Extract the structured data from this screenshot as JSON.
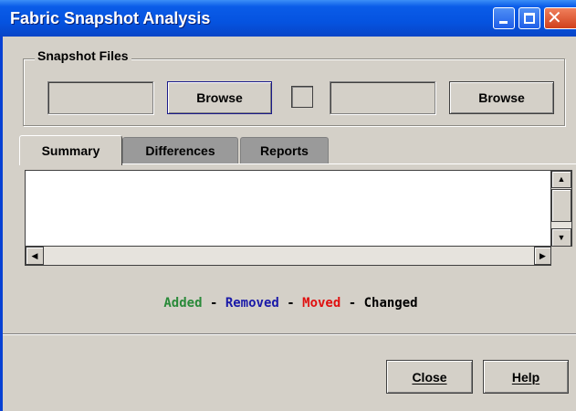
{
  "window": {
    "title": "Fabric Snapshot Analysis"
  },
  "snapshot_files": {
    "legend": "Snapshot Files",
    "left_file_value": "",
    "left_browse_label": "Browse",
    "right_file_value": "",
    "right_browse_label": "Browse"
  },
  "tabs": [
    {
      "label": "Summary",
      "active": true
    },
    {
      "label": "Differences",
      "active": false
    },
    {
      "label": "Reports",
      "active": false
    }
  ],
  "summary_text": "",
  "legend": {
    "added": {
      "label": "Added",
      "color": "#2a8a3a"
    },
    "removed": {
      "label": "Removed",
      "color": "#1a1aa8"
    },
    "moved": {
      "label": "Moved",
      "color": "#e01010"
    },
    "changed": {
      "label": "Changed",
      "color": "#000000"
    },
    "separator": " - "
  },
  "footer": {
    "close_label": "Close",
    "help_label": "Help"
  },
  "colors": {
    "titlebar": "#0553e0",
    "window_bg": "#d4d0c8"
  }
}
